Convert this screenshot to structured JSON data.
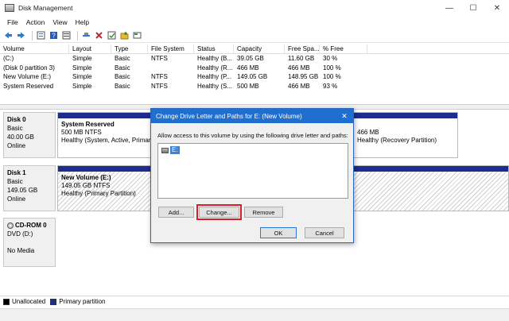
{
  "window": {
    "title": "Disk Management",
    "controls": {
      "minimize": "—",
      "maximize": "☐",
      "close": "✕"
    }
  },
  "menu": [
    "File",
    "Action",
    "View",
    "Help"
  ],
  "volume_table": {
    "headers": [
      "Volume",
      "Layout",
      "Type",
      "File System",
      "Status",
      "Capacity",
      "Free Spa...",
      "% Free"
    ],
    "rows": [
      [
        "(C:)",
        "Simple",
        "Basic",
        "NTFS",
        "Healthy (B...",
        "39.05 GB",
        "11.60 GB",
        "30 %"
      ],
      [
        "(Disk 0 partition 3)",
        "Simple",
        "Basic",
        "",
        "Healthy (R...",
        "466 MB",
        "466 MB",
        "100 %"
      ],
      [
        "New Volume (E:)",
        "Simple",
        "Basic",
        "NTFS",
        "Healthy (P...",
        "149.05 GB",
        "148.95 GB",
        "100 %"
      ],
      [
        "System Reserved",
        "Simple",
        "Basic",
        "NTFS",
        "Healthy (S...",
        "500 MB",
        "466 MB",
        "93 %"
      ]
    ]
  },
  "disks": {
    "disk0": {
      "name": "Disk 0",
      "type": "Basic",
      "size": "40.00 GB",
      "status": "Online",
      "p1": {
        "name": "System Reserved",
        "size": "500 MB NTFS",
        "status": "Healthy (System, Active, Primar"
      },
      "p3": {
        "size": "466 MB",
        "status": "Healthy (Recovery Partition)"
      }
    },
    "disk1": {
      "name": "Disk 1",
      "type": "Basic",
      "size": "149.05 GB",
      "status": "Online",
      "p1": {
        "name": "New Volume  (E:)",
        "size": "149.05 GB NTFS",
        "status": "Healthy (Primary Partition)"
      }
    },
    "cdrom": {
      "name": "CD-ROM 0",
      "type": "DVD (D:)",
      "status": "No Media"
    }
  },
  "legend": {
    "unallocated": "Unallocated",
    "primary": "Primary partition"
  },
  "dialog": {
    "title": "Change Drive Letter and Paths for E: (New Volume)",
    "close": "✕",
    "description": "Allow access to this volume by using the following drive letter and paths:",
    "items": [
      "E:"
    ],
    "buttons": {
      "add": "Add...",
      "change": "Change...",
      "remove": "Remove",
      "ok": "OK",
      "cancel": "Cancel"
    }
  },
  "colors": {
    "primary_partition": "#1c2d8e",
    "dialog_titlebar": "#1f6fd0",
    "highlight": "#d3202a"
  }
}
